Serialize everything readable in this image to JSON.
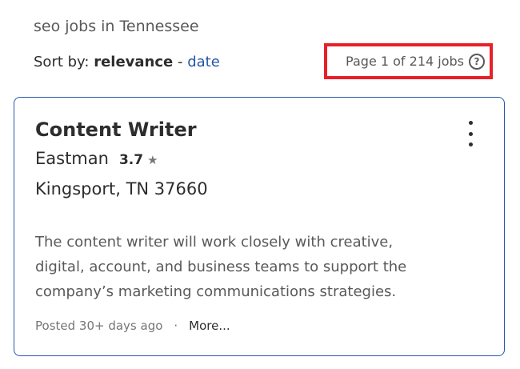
{
  "search": {
    "heading": "seo jobs in Tennessee"
  },
  "sort": {
    "label": "Sort by:",
    "active": "relevance",
    "separator": "-",
    "alternate": "date"
  },
  "pagination": {
    "count_text": "Page 1 of 214 jobs",
    "help_glyph": "?",
    "highlight_color": "#e8202a"
  },
  "job_card": {
    "title": "Content Writer",
    "company": "Eastman",
    "rating": "3.7",
    "rating_icon": "star-icon",
    "location": "Kingsport, TN 37660",
    "snippet_lines": [
      "The content writer will work closely with creative,",
      "digital, account, and business teams to support the",
      "company’s marketing communications strategies."
    ],
    "posted": "Posted 30+ days ago",
    "meta_separator": "·",
    "more_label": "More...",
    "border_color": "#2557a7"
  },
  "colors": {
    "link": "#2557a7",
    "text_primary": "#2d2d2d",
    "text_secondary": "#595959",
    "text_muted": "#767676"
  }
}
